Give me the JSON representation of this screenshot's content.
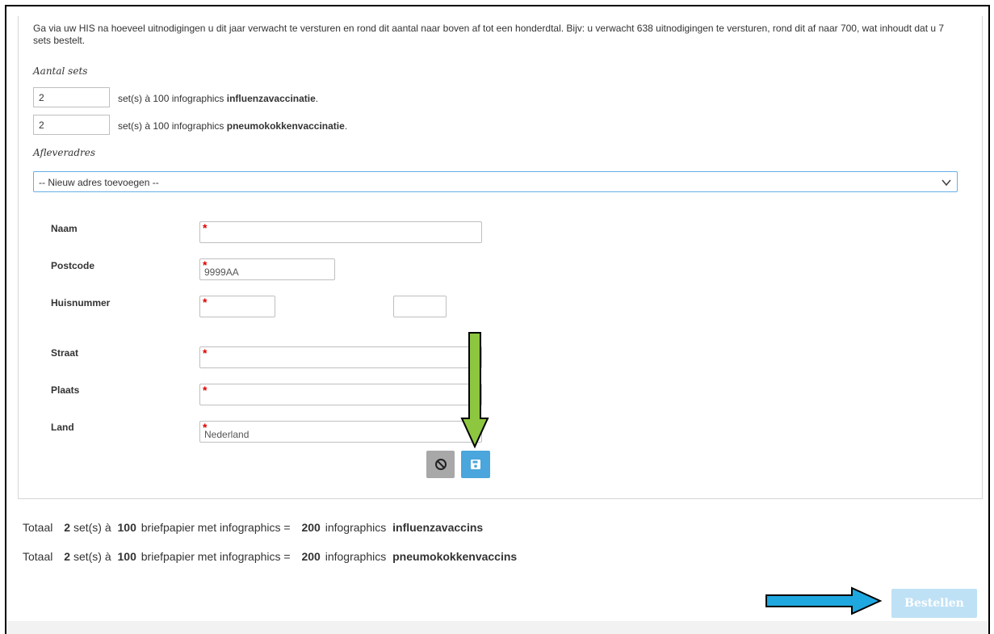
{
  "intro": "Ga via uw HIS na hoeveel uitnodigingen u dit jaar verwacht te versturen en rond dit aantal naar boven af tot een honderdtal. Bijv: u verwacht 638 uitnodigingen te versturen, rond dit af naar 700, wat inhoudt dat u 7 sets bestelt.",
  "sets": {
    "label": "Aantal sets",
    "rows": [
      {
        "value": "2",
        "prefix": "set(s) à 100 infographics ",
        "bold": "influenzavaccinatie",
        "suffix": "."
      },
      {
        "value": "2",
        "prefix": "set(s) à 100 infographics ",
        "bold": "pneumokokkenvaccinatie",
        "suffix": "."
      }
    ]
  },
  "address": {
    "label": "Afleveradres",
    "selected": "-- Nieuw adres toevoegen --"
  },
  "form": {
    "required_mark": "*",
    "naam": {
      "label": "Naam",
      "value": ""
    },
    "postcode": {
      "label": "Postcode",
      "value": "9999AA"
    },
    "huisnummer": {
      "label": "Huisnummer",
      "value": "",
      "toevoeging": ""
    },
    "straat": {
      "label": "Straat",
      "value": ""
    },
    "plaats": {
      "label": "Plaats",
      "value": ""
    },
    "land": {
      "label": "Land",
      "value": "Nederland"
    }
  },
  "totals": [
    {
      "lead": "Totaal",
      "sets": "2",
      "mid1": "set(s) à",
      "per": "100",
      "mid2": "briefpapier met infographics =",
      "count": "200",
      "mid3": "infographics",
      "product": "influenzavaccins"
    },
    {
      "lead": "Totaal",
      "sets": "2",
      "mid1": "set(s) à",
      "per": "100",
      "mid2": "briefpapier met infographics =",
      "count": "200",
      "mid3": "infographics",
      "product": "pneumokokkenvaccins"
    }
  ],
  "order_button": "Bestellen",
  "colors": {
    "save_button": "#4aa6dc",
    "cancel_button": "#a8a8a8",
    "order_button": "#bfe1f5",
    "required": "#e00000",
    "green_arrow": "#8dc63f",
    "blue_arrow": "#1fa7e0"
  }
}
